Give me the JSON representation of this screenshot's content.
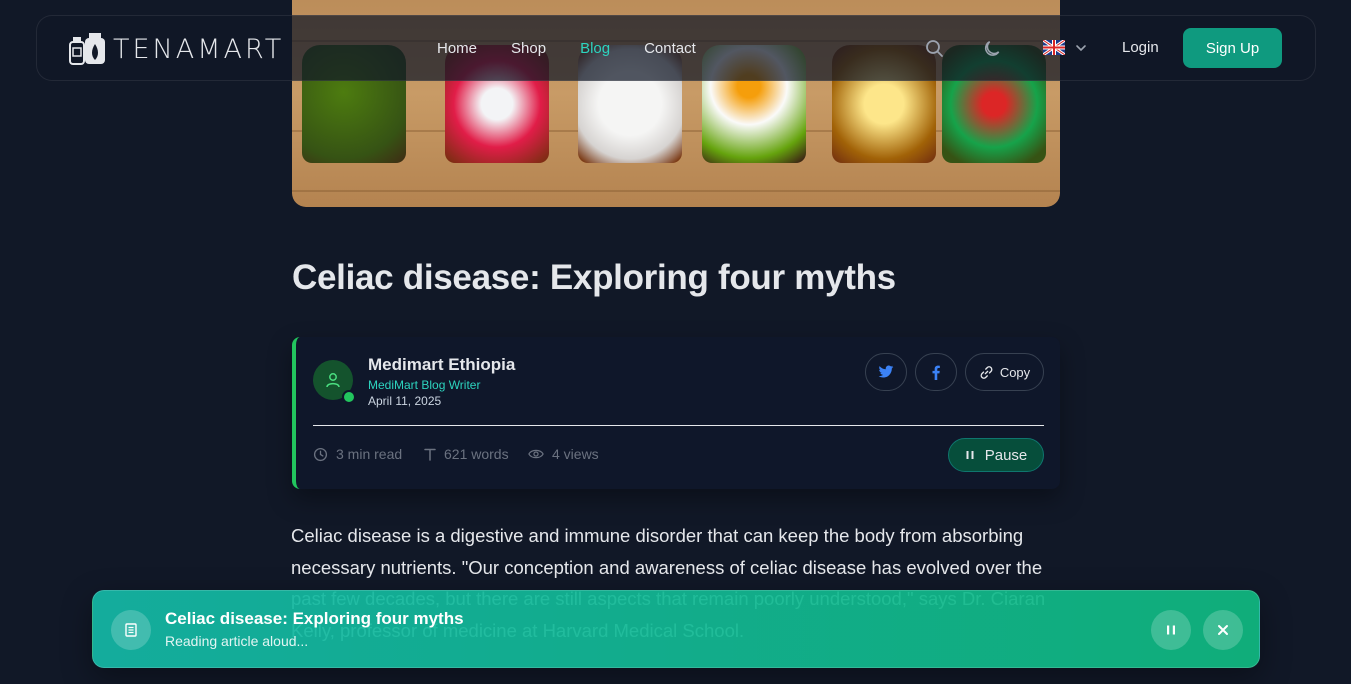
{
  "brand": {
    "name": "TENAMART"
  },
  "nav": {
    "links": [
      "Home",
      "Shop",
      "Blog",
      "Contact"
    ],
    "active": "Blog",
    "login_label": "Login",
    "signup_label": "Sign Up",
    "language": "en-GB"
  },
  "article": {
    "title": "Celiac disease: Exploring four myths",
    "author": {
      "name": "Medimart Ethiopia",
      "role": "MediMart Blog Writer",
      "date": "April 11, 2025"
    },
    "share": {
      "copy_label": "Copy"
    },
    "stats": {
      "read_time": "3 min read",
      "words": "621 words",
      "views": "4 views"
    },
    "audio_button_label": "Pause",
    "body": "Celiac disease is a digestive and immune disorder that can keep the body from absorbing necessary nutrients. \"Our conception and awareness of celiac disease has evolved over the past few decades, but there are still aspects that remain poorly understood,\" says Dr. Ciaran Kelly, professor of medicine at Harvard Medical School."
  },
  "tts_toast": {
    "title": "Celiac disease: Exploring four myths",
    "status": "Reading article aloud..."
  },
  "colors": {
    "background": "#111827",
    "accent": "#0f9a7f",
    "active_link": "#2dd4bf",
    "card_border": "#22c55e",
    "toast": "#14b8a6"
  },
  "icons": [
    "search-icon",
    "moon-icon",
    "flag-uk-icon",
    "chevron-down-icon",
    "user-icon",
    "verified-icon",
    "twitter-icon",
    "facebook-icon",
    "link-icon",
    "clock-icon",
    "text-icon",
    "eye-icon",
    "pause-icon",
    "document-icon",
    "close-icon"
  ]
}
